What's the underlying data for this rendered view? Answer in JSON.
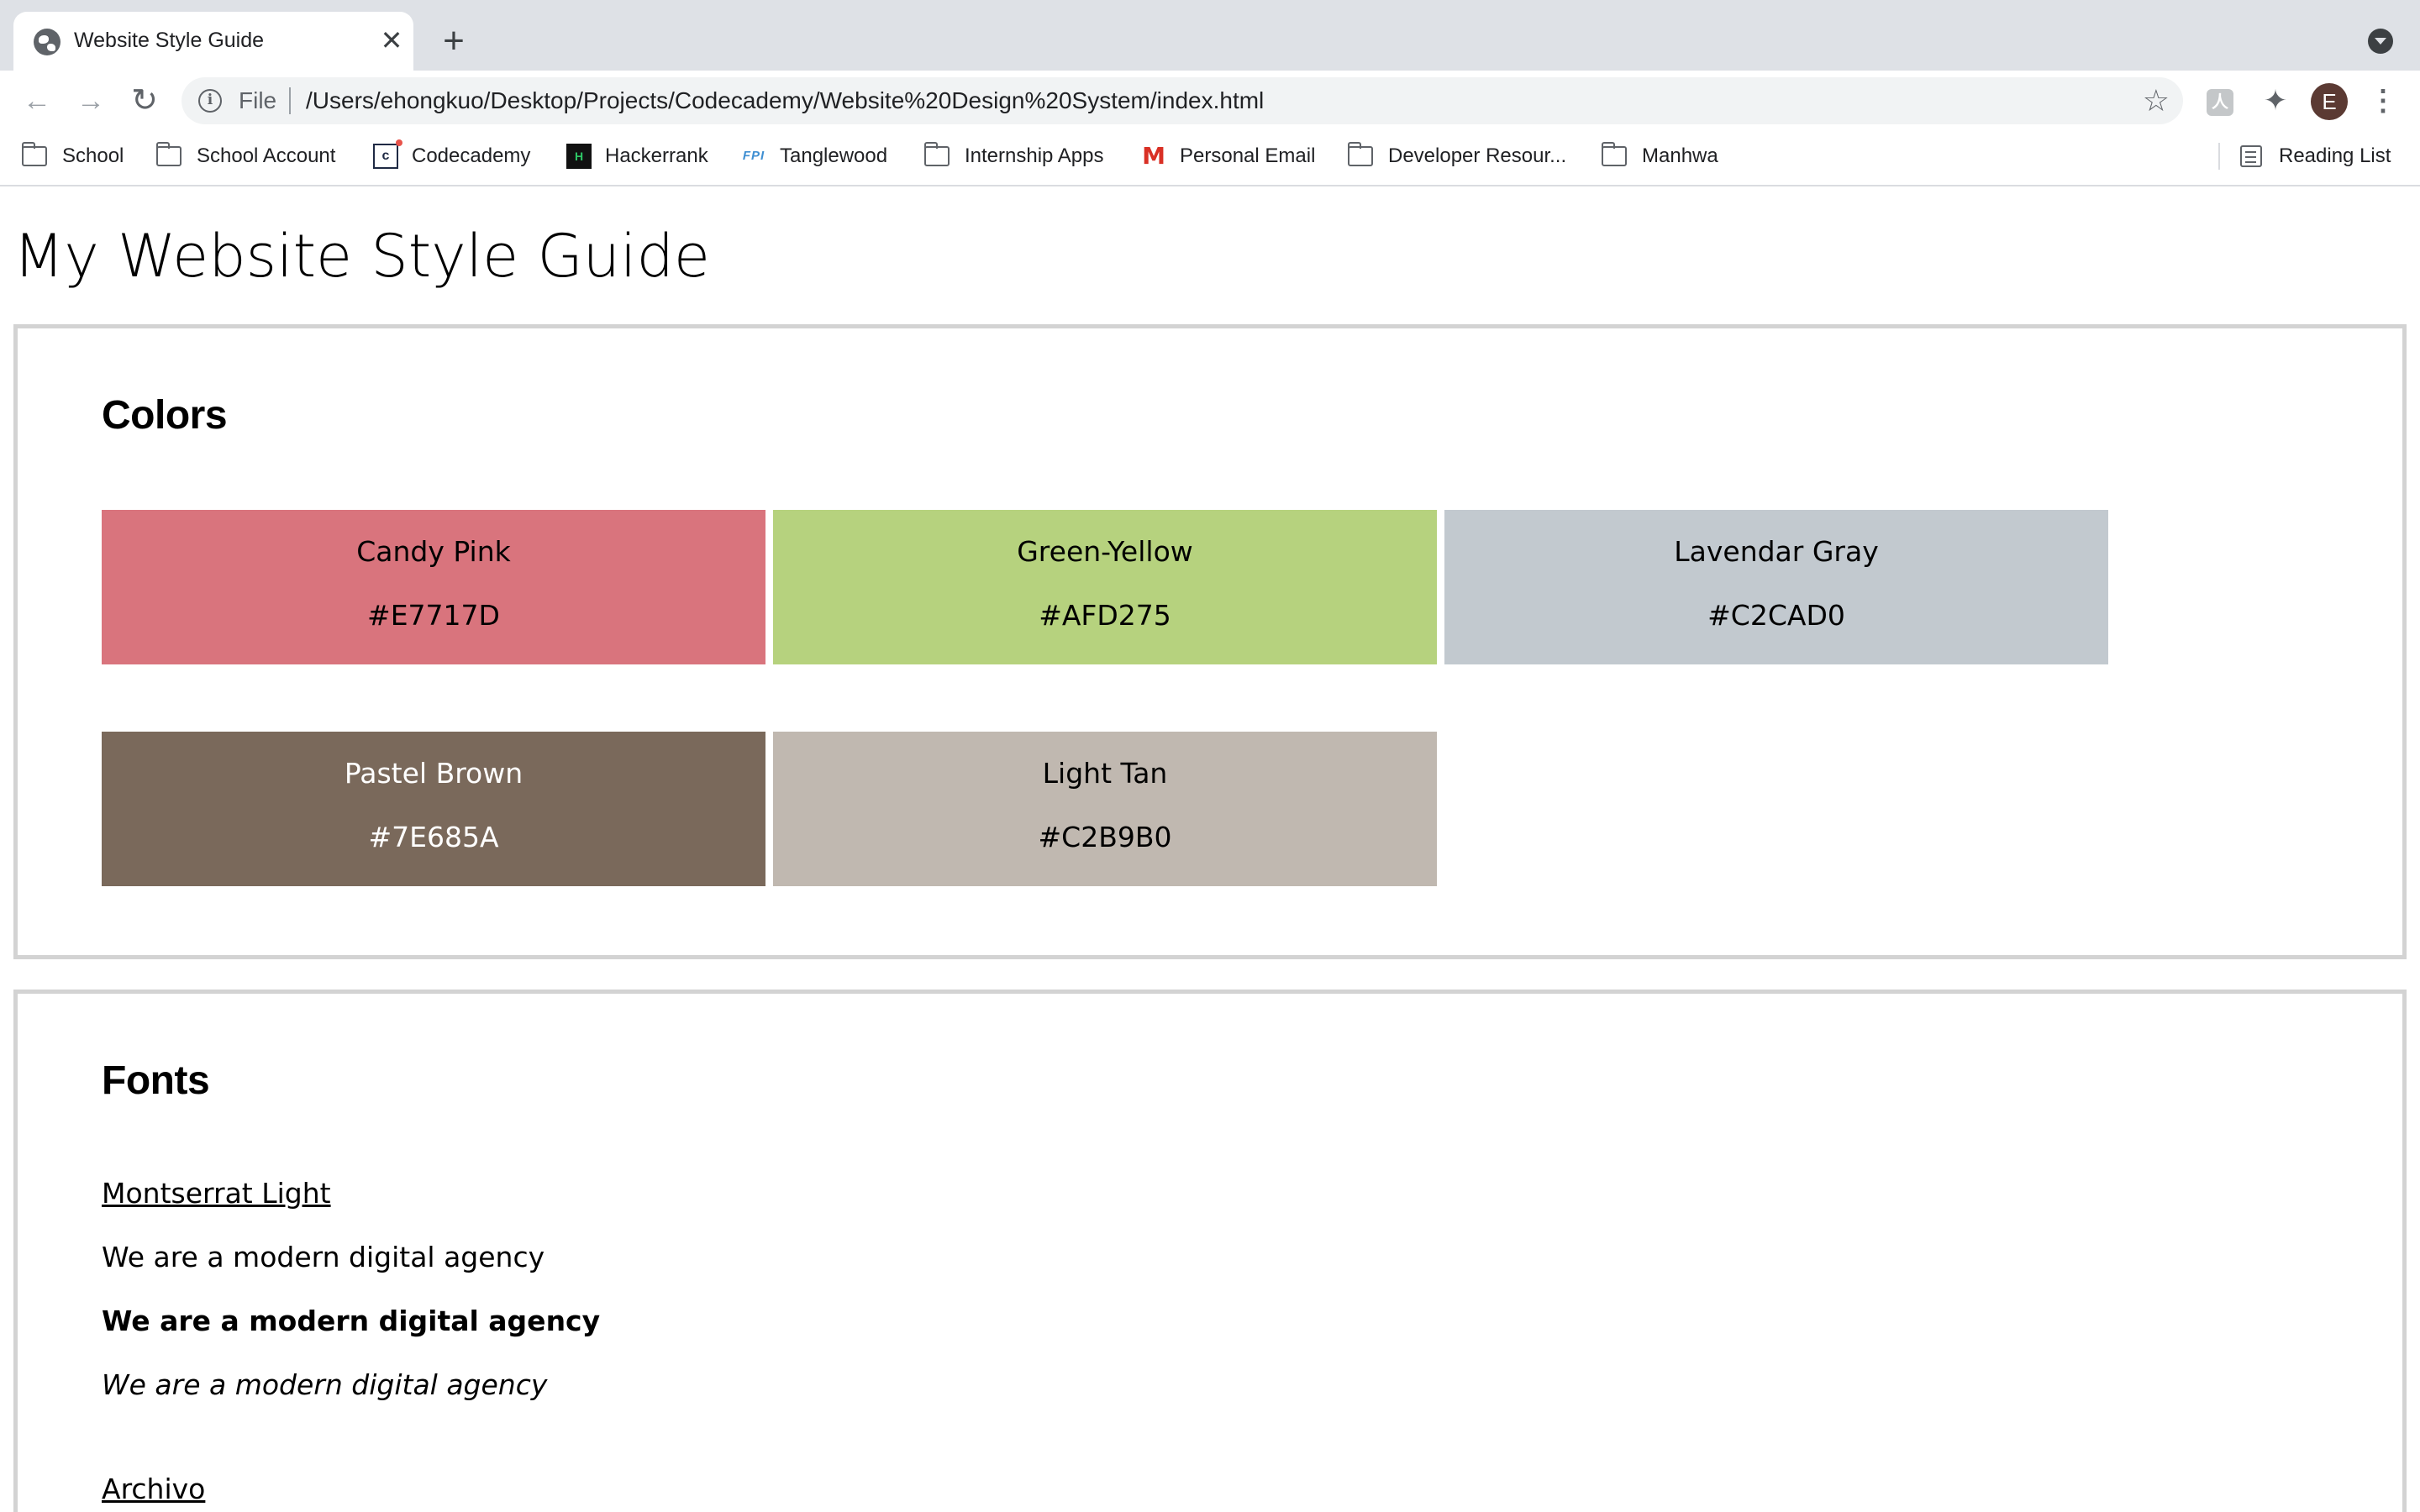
{
  "browser": {
    "tab": {
      "title": "Website Style Guide",
      "close": "✕"
    },
    "new_tab": "+",
    "address": {
      "scheme": "File",
      "url": "/Users/ehongkuo/Desktop/Projects/Codecademy/Website%20Design%20System/index.html"
    },
    "profile_initial": "E",
    "bookmarks": [
      {
        "label": "School",
        "icon": "folder-icon"
      },
      {
        "label": "School Account",
        "icon": "folder-icon"
      },
      {
        "label": "Codecademy",
        "icon": "codecademy-icon"
      },
      {
        "label": "Hackerrank",
        "icon": "hackerrank-icon"
      },
      {
        "label": "Tanglewood",
        "icon": "fpi-icon"
      },
      {
        "label": "Internship Apps",
        "icon": "folder-icon"
      },
      {
        "label": "Personal Email",
        "icon": "gmail-icon"
      },
      {
        "label": "Developer Resour...",
        "icon": "folder-icon"
      },
      {
        "label": "Manhwa",
        "icon": "folder-icon"
      }
    ],
    "reading_list": "Reading List"
  },
  "page": {
    "title": "My Website Style Guide",
    "colors": {
      "heading": "Colors",
      "swatches": [
        {
          "name": "Candy Pink",
          "hex": "#E7717D",
          "bg": "#D9747D",
          "fg": "#000000"
        },
        {
          "name": "Green-Yellow",
          "hex": "#AFD275",
          "bg": "#B6D27E",
          "fg": "#000000"
        },
        {
          "name": "Lavendar Gray",
          "hex": "#C2CAD0",
          "bg": "#C2C9CF",
          "fg": "#000000"
        },
        {
          "name": "Pastel Brown",
          "hex": "#7E685A",
          "bg": "#7A695B",
          "fg": "#FFFFFF"
        },
        {
          "name": "Light Tan",
          "hex": "#C2B9B0",
          "bg": "#C0B8B0",
          "fg": "#000000"
        }
      ]
    },
    "fonts": {
      "heading": "Fonts",
      "families": [
        {
          "name": "Montserrat Light",
          "samples": [
            "We are a modern digital agency",
            "We are a modern digital agency",
            "We are a modern digital agency"
          ]
        },
        {
          "name": "Archivo"
        }
      ]
    }
  }
}
